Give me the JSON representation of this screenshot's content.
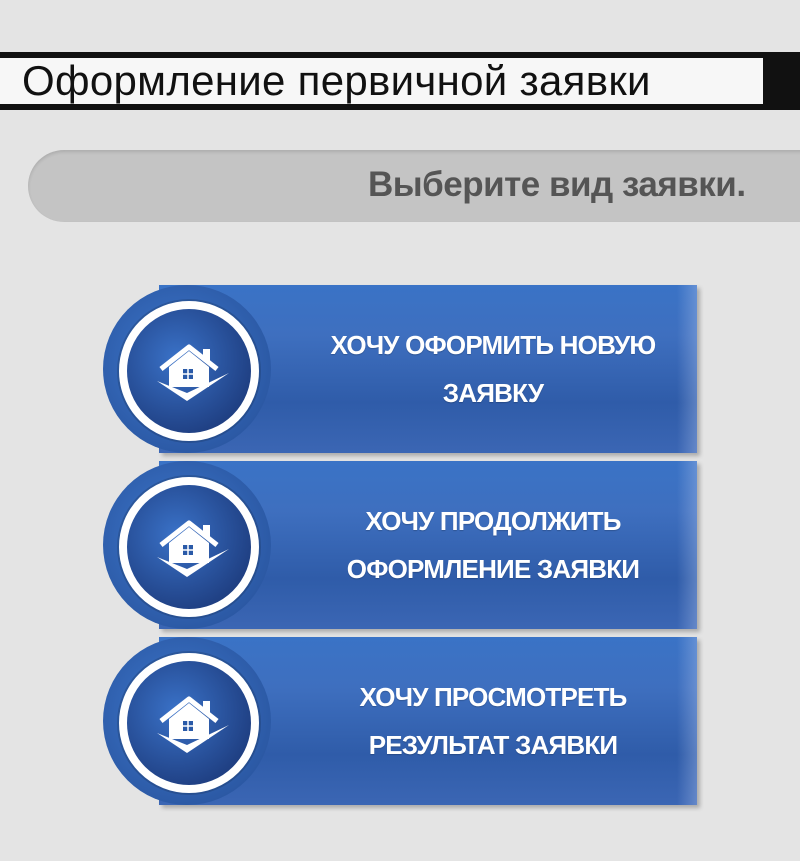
{
  "header": {
    "title": "Оформление первичной заявки"
  },
  "subtitle": {
    "text": "Выберите вид заявки."
  },
  "options": [
    {
      "line1": "ХОЧУ ОФОРМИТЬ НОВУЮ",
      "line2": "ЗАЯВКУ",
      "icon": "house-check-icon"
    },
    {
      "line1": "ХОЧУ ПРОДОЛЖИТЬ",
      "line2": "ОФОРМЛЕНИЕ ЗАЯВКИ",
      "icon": "house-check-icon"
    },
    {
      "line1": "ХОЧУ ПРОСМОТРЕТЬ",
      "line2": "РЕЗУЛЬТАТ ЗАЯВКИ",
      "icon": "house-check-icon"
    }
  ],
  "colors": {
    "background": "#e4e4e4",
    "header_bar": "#111111",
    "subtitle_bar": "#c4c4c4",
    "button_blue": "#3a6bbd",
    "text_white": "#ffffff"
  }
}
